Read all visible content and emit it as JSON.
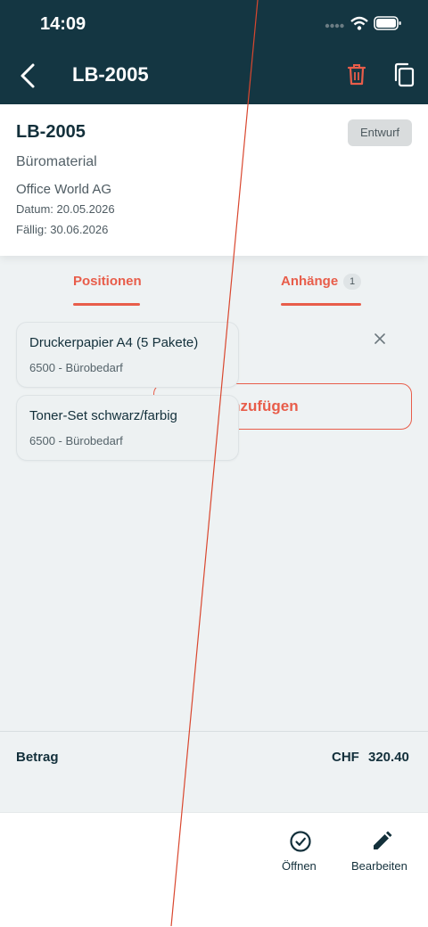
{
  "status_bar": {
    "time": "14:09"
  },
  "nav": {
    "title": "LB-2005"
  },
  "card": {
    "id": "LB-2005",
    "status": "Entwurf",
    "category": "Büromaterial",
    "vendor": "Office World AG",
    "date": "Datum: 20.05.2026",
    "due": "Fällig: 30.06.2026"
  },
  "tabs": [
    {
      "label": "Positionen"
    },
    {
      "label": "Anhänge",
      "count": "1"
    }
  ],
  "attachment": {
    "add_label": "hinzufügen"
  },
  "items": [
    {
      "title": "Druckerpapier A4 (5 Pakete)",
      "subtitle": "6500 - Bürobedarf"
    },
    {
      "title": "Toner-Set schwarz/farbig",
      "subtitle": "6500 - Bürobedarf"
    }
  ],
  "summary": {
    "label": "Betrag",
    "currency": "CHF",
    "value": "320.40"
  },
  "toolbar": {
    "open_label": "Öffnen",
    "edit_label": "Bearbeiten"
  },
  "colors": {
    "header": "#143642",
    "accent": "#e85d4a",
    "background": "#eef2f3"
  },
  "icons": [
    "back-arrow-icon",
    "trash-icon",
    "copy-icon",
    "close-icon",
    "check-circle-icon",
    "pencil-icon",
    "wifi-icon",
    "battery-icon",
    "signal-icon"
  ]
}
